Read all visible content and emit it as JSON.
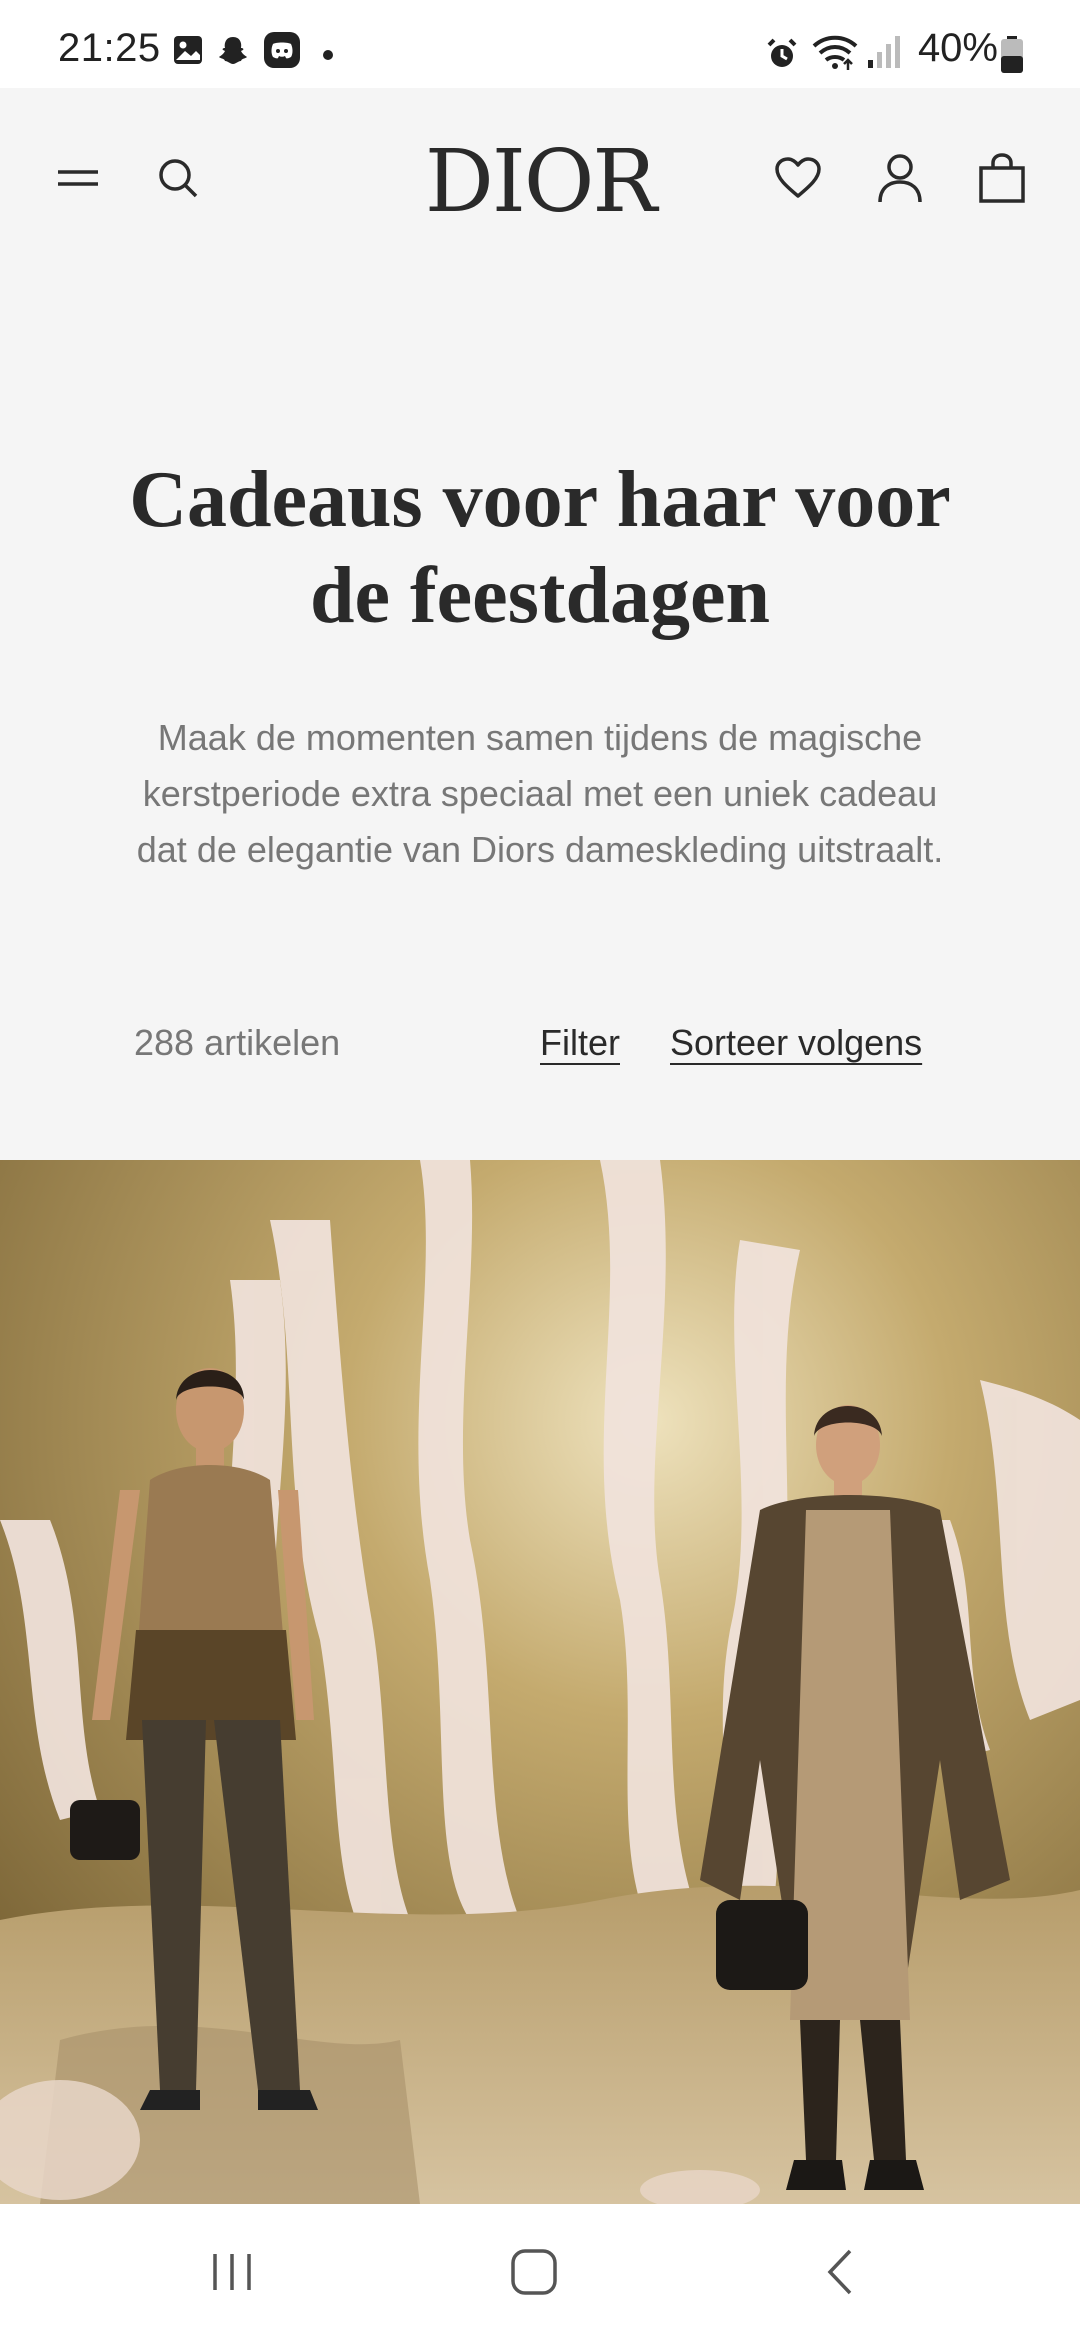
{
  "status_bar": {
    "time": "21:25",
    "battery": "40%",
    "icons": [
      "gallery-icon",
      "snapchat-icon",
      "discord-icon",
      "dot-icon",
      "alarm-icon",
      "wifi-icon",
      "signal-icon",
      "battery-icon"
    ]
  },
  "header": {
    "logo": "DIOR",
    "icons": [
      "menu-icon",
      "search-icon",
      "heart-icon",
      "account-icon",
      "bag-icon"
    ]
  },
  "page": {
    "title": "Cadeaus voor haar voor de feestdagen",
    "description": "Maak de momenten samen tijdens de magische kerstperiode extra speciaal met een uniek cadeau dat de elegantie van Diors dameskleding uitstraalt.",
    "results_count": "288 artikelen",
    "filter_label": "Filter",
    "sort_label": "Sorteer volgens"
  },
  "colors": {
    "background": "#f5f5f5",
    "text_dark": "#2a2a2a",
    "text_muted": "#777777"
  },
  "nav_bar": {
    "icons": [
      "recent-apps-icon",
      "home-icon",
      "back-icon"
    ]
  }
}
